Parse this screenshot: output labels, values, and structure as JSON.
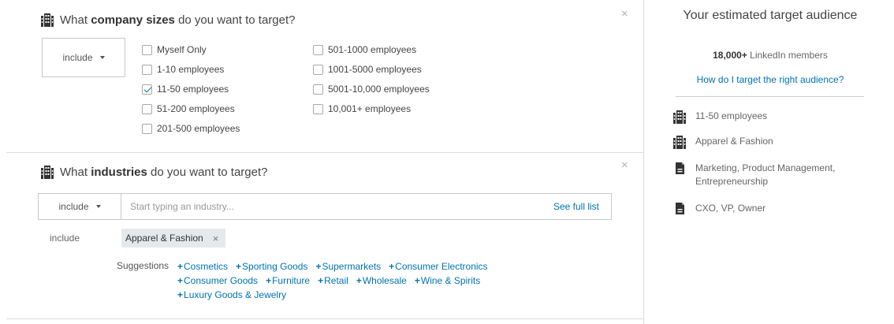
{
  "company_sizes": {
    "title_pre": "What ",
    "title_bold": "company sizes",
    "title_post": " do you want to target?",
    "include_label": "include",
    "options_col1": [
      {
        "label": "Myself Only",
        "checked": false
      },
      {
        "label": "1-10 employees",
        "checked": false
      },
      {
        "label": "11-50 employees",
        "checked": true
      },
      {
        "label": "51-200 employees",
        "checked": false
      },
      {
        "label": "201-500 employees",
        "checked": false
      }
    ],
    "options_col2": [
      {
        "label": "501-1000 employees",
        "checked": false
      },
      {
        "label": "1001-5000 employees",
        "checked": false
      },
      {
        "label": "5001-10,000 employees",
        "checked": false
      },
      {
        "label": "10,001+ employees",
        "checked": false
      }
    ]
  },
  "industries": {
    "title_pre": "What ",
    "title_bold": "industries",
    "title_post": " do you want to target?",
    "include_label": "include",
    "input_placeholder": "Start typing an industry...",
    "see_full_list": "See full list",
    "selected_label": "include",
    "selected_chip": "Apparel & Fashion",
    "chip_remove": "×",
    "suggestions_label": "Suggestions",
    "suggestion_lines": [
      [
        "Cosmetics",
        "Sporting Goods",
        "Supermarkets",
        "Consumer Electronics"
      ],
      [
        "Consumer Goods",
        "Furniture",
        "Retail",
        "Wholesale",
        "Wine & Spirits"
      ],
      [
        "Luxury Goods & Jewelry"
      ]
    ]
  },
  "close_symbol": "×",
  "plus_symbol": "+",
  "sidebar": {
    "title": "Your estimated target audience",
    "count_bold": "18,000+",
    "count_rest": " LinkedIn members",
    "help_link": "How do I target the right audience?",
    "summary": [
      {
        "icon": "building-icon",
        "text": "11-50 employees"
      },
      {
        "icon": "building-icon",
        "text": "Apparel & Fashion"
      },
      {
        "icon": "document-icon",
        "text": "Marketing, Product Management, Entrepreneurship"
      },
      {
        "icon": "document-icon",
        "text": "CXO, VP, Owner"
      }
    ]
  },
  "colors": {
    "link": "#0073b1",
    "border": "#dcdcdc",
    "chip_bg": "#e6e9ec",
    "check": "#0073b1"
  }
}
